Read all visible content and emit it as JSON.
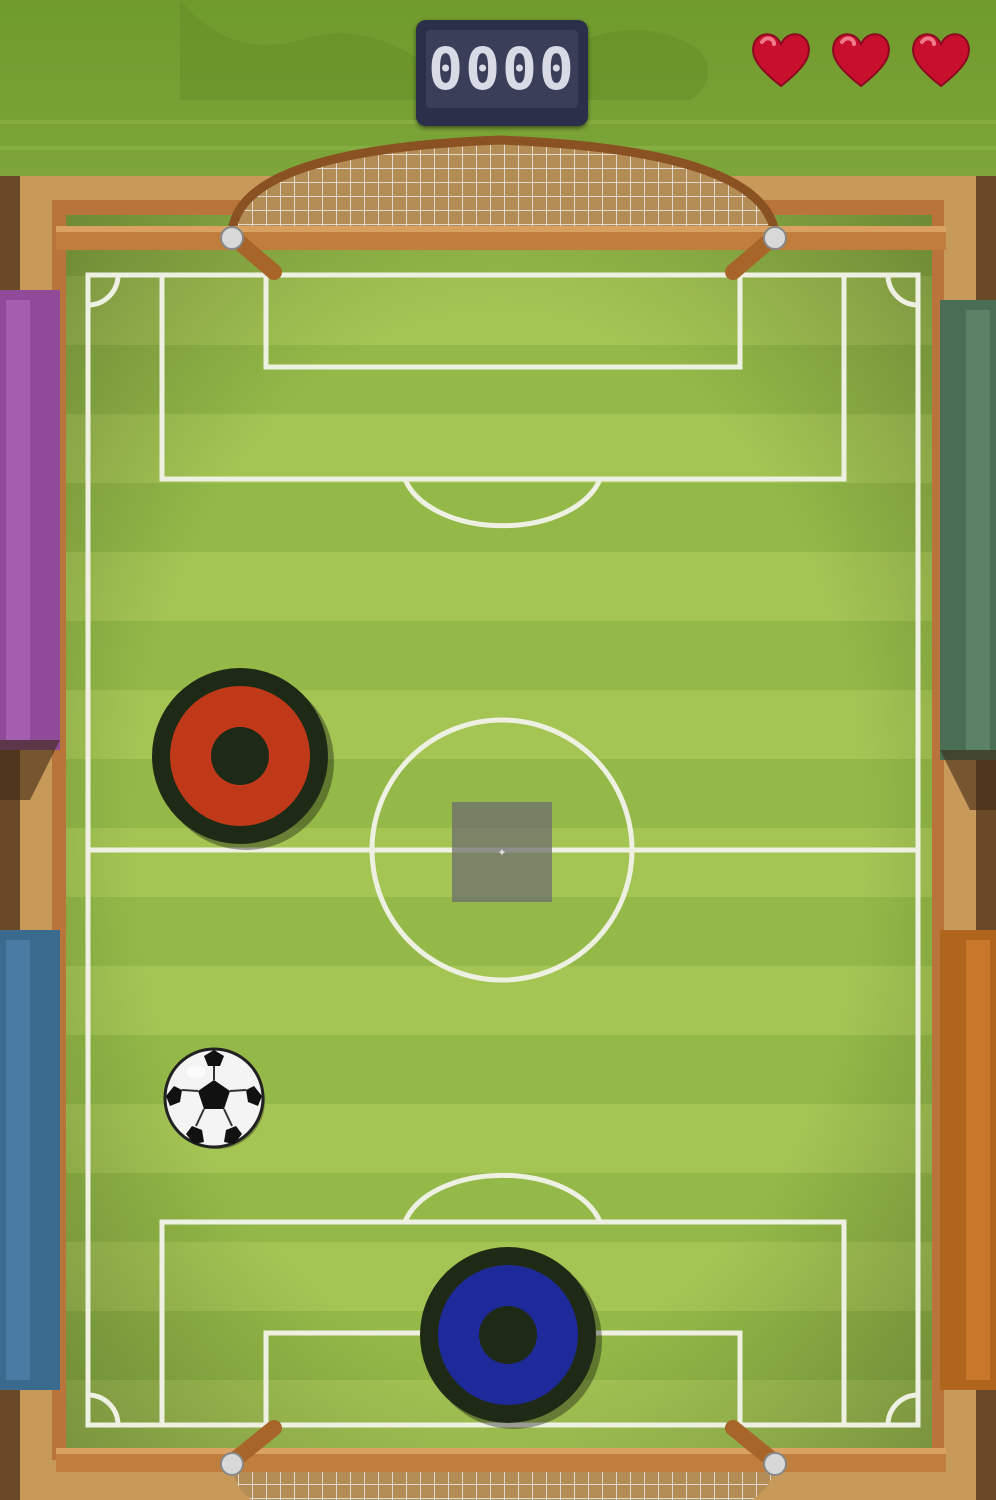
{
  "game": {
    "title": "",
    "score": "0000",
    "lives": 3,
    "lives_label": "lives",
    "colors": {
      "field_light": "#a9c95a",
      "field_dark": "#8fb448",
      "line": "#eef0e2",
      "wood": "#b8743a",
      "opponent_mallet": "#c03a1a",
      "player_mallet": "#1f2a9a",
      "mallet_rim": "#1f2a16",
      "heart": "#c8102e",
      "score_bg": "#2b2f4a"
    }
  },
  "field": {
    "center_spot_icon": "crosshair-icon",
    "center_spot_glyph": "✦"
  },
  "pieces": {
    "opponent": {
      "name": "opponent-mallet",
      "color": "red"
    },
    "player": {
      "name": "player-mallet",
      "color": "blue"
    },
    "ball": {
      "name": "soccer-ball"
    }
  }
}
